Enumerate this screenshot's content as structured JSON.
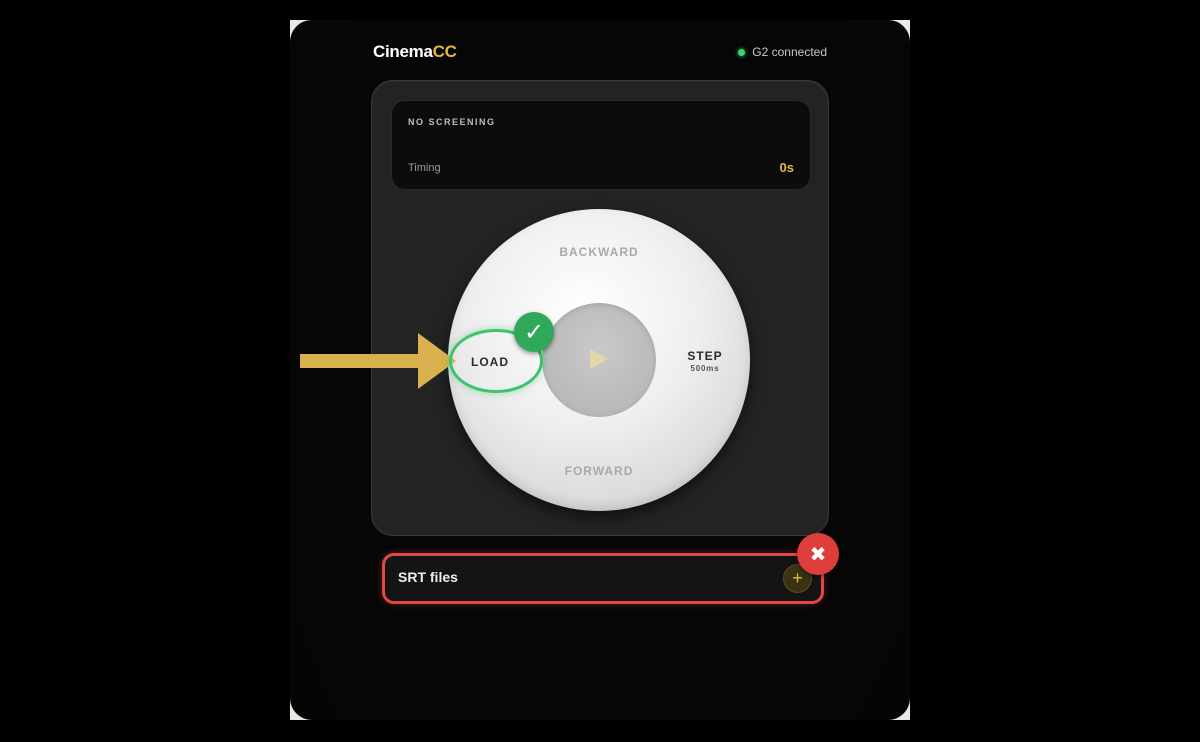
{
  "app": {
    "brand_part1": "Cinema",
    "brand_part2": "CC",
    "connection_status": "G2 connected"
  },
  "screen": {
    "status": "NO SCREENING",
    "timing_label": "Timing",
    "timing_value": "0s"
  },
  "dial": {
    "backward_label": "BACKWARD",
    "forward_label": "FORWARD",
    "load_label": "LOAD",
    "step_label": "STEP",
    "step_sub_label": "500ms",
    "center_icon": "play-icon"
  },
  "srt": {
    "label": "SRT files",
    "add_icon": "+"
  },
  "annotations": {
    "check_symbol": "✓",
    "cross_symbol": "✖"
  },
  "colors": {
    "accent": "#e2b73e",
    "connected": "#3ecf6e",
    "annotation_good": "#3cc46d",
    "annotation_bad": "#e04848"
  }
}
